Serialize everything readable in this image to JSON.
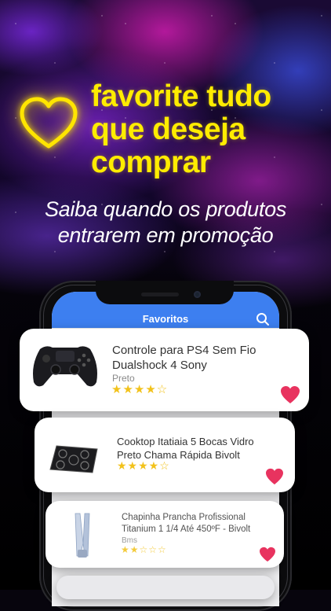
{
  "promo": {
    "headline_lines": [
      "favorite tudo",
      "que deseja",
      "comprar"
    ],
    "subtitle_lines": [
      "Saiba quando os produtos",
      "entrarem em promoção"
    ],
    "headline_color": "#ffec00"
  },
  "app": {
    "title": "Favoritos",
    "header_color": "#3d7ff0",
    "search_icon": "search-icon"
  },
  "products": [
    {
      "name_lines": [
        "Controle para PS4 Sem Fio",
        "Dualshock 4 Sony"
      ],
      "color": "Preto",
      "rating": 4,
      "rating_max": 5,
      "stars": "★★★★☆",
      "favorited": true
    },
    {
      "name_lines": [
        "Cooktop Itatiaia 5 Bocas Vidro",
        "Preto Chama Rápida Bivolt"
      ],
      "rating": 4,
      "rating_max": 5,
      "stars": "★★★★☆",
      "favorited": true
    },
    {
      "name_lines": [
        "Chapinha Prancha Profissional",
        "Titanium 1 1/4 Até 450ºF - Bivolt"
      ],
      "color": "Bms",
      "rating": 2,
      "rating_max": 5,
      "stars": "★★☆☆☆",
      "favorited": true
    }
  ],
  "colors": {
    "favorite_heart": "#e8335f",
    "star": "#f2c21b"
  }
}
